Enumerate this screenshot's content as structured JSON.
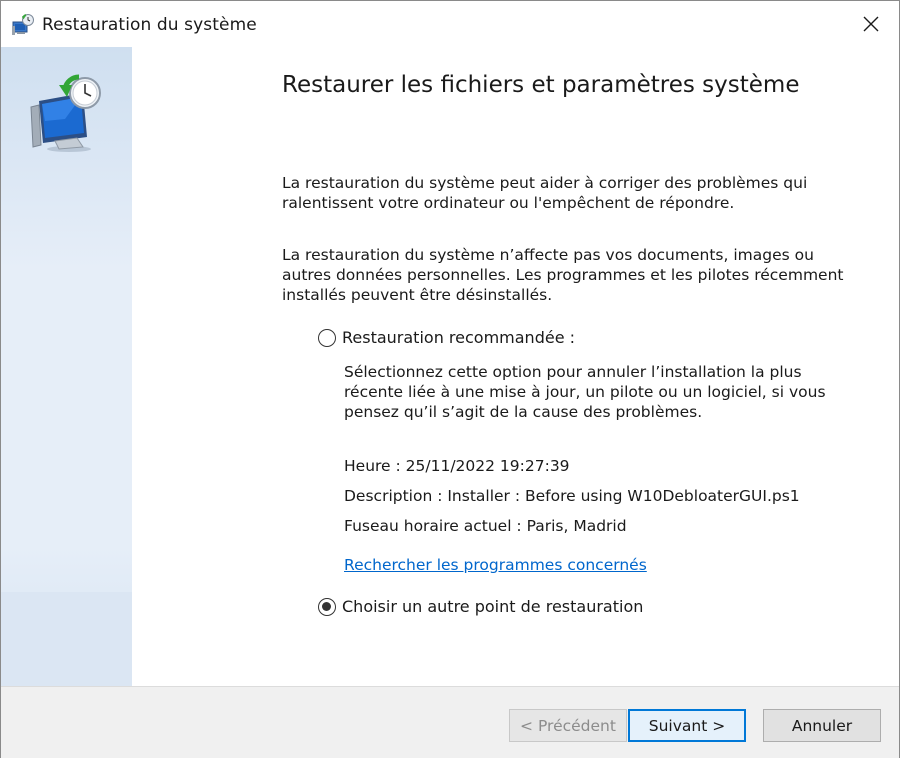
{
  "window": {
    "title": "Restauration du système",
    "icon": "system-restore-icon",
    "close_icon": "close-icon"
  },
  "main": {
    "heading": "Restaurer les fichiers et paramètres système",
    "paragraph1": "La restauration du système peut aider à corriger des problèmes qui ralentissent votre ordinateur ou l'empêchent de répondre.",
    "paragraph2": "La restauration du système n’affecte pas vos documents, images ou autres données personnelles. Les programmes et les pilotes récemment installés peuvent être désinstallés.",
    "option_recommended": {
      "label": "Restauration recommandée :",
      "selected": false,
      "description": "Sélectionnez cette option pour annuler l’installation la plus récente liée à une mise à jour, un pilote ou un logiciel, si vous pensez qu’il s’agit de la cause des problèmes.",
      "time": "Heure : 25/11/2022 19:27:39",
      "description_line": "Description : Installer : Before using W10DebloaterGUI.ps1",
      "timezone": "Fuseau horaire actuel : Paris, Madrid",
      "link": "Rechercher les programmes concernés"
    },
    "option_other": {
      "label": "Choisir un autre point de restauration",
      "selected": true
    }
  },
  "footer": {
    "prev_label": "< Précédent",
    "next_label": "Suivant >",
    "cancel_label": "Annuler"
  },
  "colors": {
    "accent": "#0078d7",
    "link": "#0066cc",
    "sidebar": "#e6eef8"
  }
}
